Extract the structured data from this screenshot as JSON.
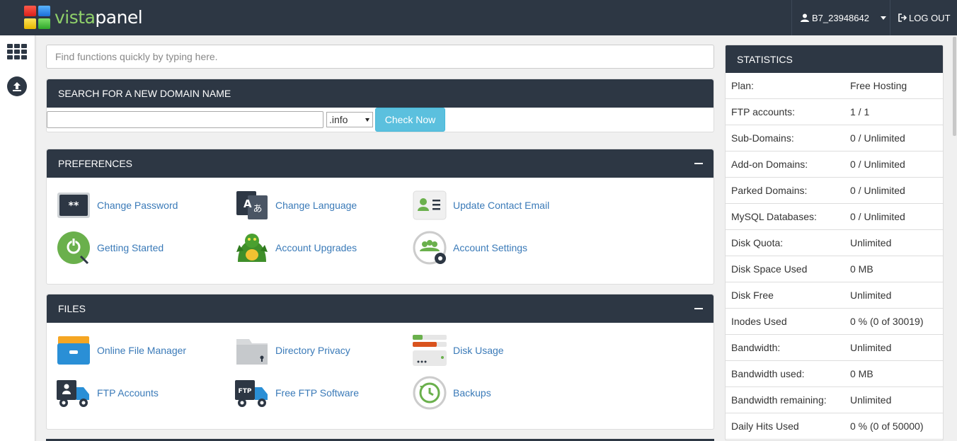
{
  "app": {
    "logo_vista": "vista",
    "logo_panel": "panel"
  },
  "header": {
    "username": "B7_23948642",
    "logout_label": "LOG OUT"
  },
  "search": {
    "placeholder": "Find functions quickly by typing here."
  },
  "domain_search": {
    "title": "SEARCH FOR A NEW DOMAIN NAME",
    "tld_selected": ".info",
    "button_label": "Check Now"
  },
  "preferences": {
    "title": "PREFERENCES",
    "items": [
      {
        "label": "Change Password",
        "icon": "password-icon"
      },
      {
        "label": "Change Language",
        "icon": "language-icon"
      },
      {
        "label": "Update Contact Email",
        "icon": "contact-card-icon"
      },
      {
        "label": "Getting Started",
        "icon": "getting-started-icon"
      },
      {
        "label": "Account Upgrades",
        "icon": "dragon-icon"
      },
      {
        "label": "Account Settings",
        "icon": "account-settings-icon"
      }
    ]
  },
  "files": {
    "title": "FILES",
    "items": [
      {
        "label": "Online File Manager",
        "icon": "file-manager-icon"
      },
      {
        "label": "Directory Privacy",
        "icon": "folder-lock-icon"
      },
      {
        "label": "Disk Usage",
        "icon": "disk-usage-icon"
      },
      {
        "label": "FTP Accounts",
        "icon": "ftp-truck-icon"
      },
      {
        "label": "Free FTP Software",
        "icon": "ftp-software-icon"
      },
      {
        "label": "Backups",
        "icon": "backup-icon"
      }
    ]
  },
  "statistics": {
    "title": "STATISTICS",
    "rows": [
      {
        "label": "Plan:",
        "value": "Free Hosting"
      },
      {
        "label": "FTP accounts:",
        "value": "1 / 1"
      },
      {
        "label": "Sub-Domains:",
        "value": "0 / Unlimited"
      },
      {
        "label": "Add-on Domains:",
        "value": "0 / Unlimited"
      },
      {
        "label": "Parked Domains:",
        "value": "0 / Unlimited"
      },
      {
        "label": "MySQL Databases:",
        "value": "0 / Unlimited"
      },
      {
        "label": "Disk Quota:",
        "value": "Unlimited"
      },
      {
        "label": "Disk Space Used",
        "value": "0 MB"
      },
      {
        "label": "Disk Free",
        "value": "Unlimited"
      },
      {
        "label": "Inodes Used",
        "value": "0 % (0 of 30019)"
      },
      {
        "label": "Bandwidth:",
        "value": "Unlimited"
      },
      {
        "label": "Bandwidth used:",
        "value": "0 MB"
      },
      {
        "label": "Bandwidth remaining:",
        "value": "Unlimited"
      },
      {
        "label": "Daily Hits Used",
        "value": "0 % (0 of 50000)"
      }
    ]
  },
  "colors": {
    "header_bg": "#2d3744",
    "link": "#3a7ab8",
    "button_info": "#5bc0de",
    "logo_green": "#8fd06a"
  }
}
